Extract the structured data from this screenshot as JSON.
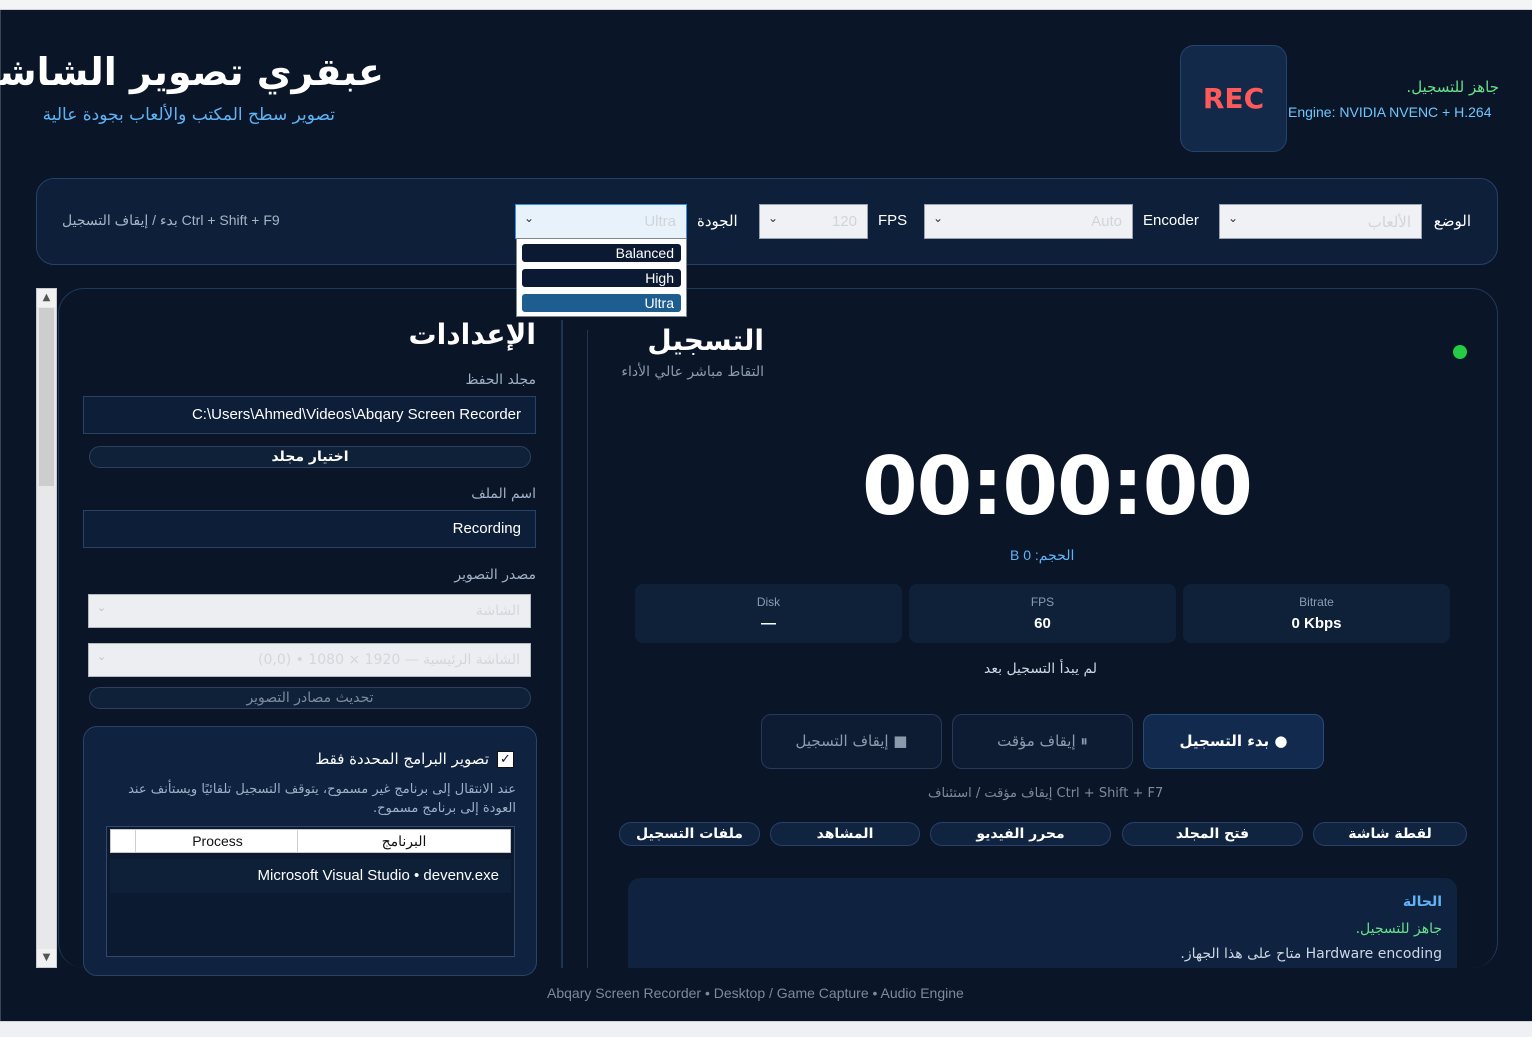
{
  "header": {
    "title": "عبقري تصوير الشاشة",
    "subtitle": "تصوير سطح المكتب والألعاب بجودة عالية",
    "rec_badge": "REC",
    "ready_text": "جاهز للتسجيل.",
    "engine_text": "Engine: NVIDIA NVENC + H.264"
  },
  "toolbar": {
    "mode_label": "الوضع",
    "mode_value": "الألعاب",
    "encoder_label": "Encoder",
    "encoder_value": "Auto",
    "fps_label": "FPS",
    "fps_value": "120",
    "quality_label": "الجودة",
    "quality_value": "Ultra",
    "quality_options": [
      "Balanced",
      "High",
      "Ultra"
    ],
    "shortcut_text": "Ctrl + Shift + F9 بدء / إيقاف التسجيل"
  },
  "settings": {
    "title": "الإعدادات",
    "save_folder_label": "مجلد الحفظ",
    "save_folder_value": "C:\\Users\\Ahmed\\Videos\\Abqary Screen Recorder",
    "choose_folder_button": "اختيار مجلد",
    "file_name_label": "اسم الملف",
    "file_name_value": "Recording",
    "capture_source_label": "مصدر التصوير",
    "source_type_value": "الشاشة",
    "source_monitor_value": "الشاشة الرئيسية — 1920 × 1080 • (0,0)",
    "refresh_sources_button": "تحديث مصادر التصوير",
    "selected_apps_checkbox": "تصوير البرامج المحددة فقط",
    "selected_apps_help": "عند الانتقال إلى برنامج غير مسموح، يتوقف التسجيل تلقائيًا ويستأنف عند العودة إلى برنامج مسموح.",
    "table_headers": [
      "البرنامج",
      "Process"
    ],
    "table_rows": [
      "Microsoft Visual Studio • devenv.exe"
    ]
  },
  "recording": {
    "title": "التسجيل",
    "subtitle": "التقاط مباشر عالي الأداء",
    "timer": "00:00:00",
    "size_text": "الحجم: 0 B",
    "stats": [
      {
        "label": "Bitrate",
        "value": "0 Kbps"
      },
      {
        "label": "FPS",
        "value": "60"
      },
      {
        "label": "Disk",
        "value": "—"
      }
    ],
    "not_started_text": "لم يبدأ التسجيل بعد",
    "start_button": "● بدء التسجيل",
    "pause_button": "⏸ إيقاف مؤقت",
    "stop_button": "■ إيقاف التسجيل",
    "pause_hint": "Ctrl + Shift + F7 إيقاف مؤقت / استئناف",
    "quick_buttons": [
      "لقطة شاشة",
      "فتح المجلد",
      "محرر الفيديو",
      "المشاهد",
      "ملفات التسجيل"
    ],
    "status_title": "الحالة",
    "status_line1": "جاهز للتسجيل.",
    "status_line2": "Hardware encoding متاح على هذا الجهاز."
  },
  "footer": "Abqary Screen Recorder • Desktop / Game Capture • Audio Engine",
  "colors": {
    "background": "#0a1628",
    "accent_blue": "#5fb3f5",
    "rec_red": "#ff5a5a",
    "ready_green": "#66e08a",
    "status_dot": "#22cc44"
  }
}
